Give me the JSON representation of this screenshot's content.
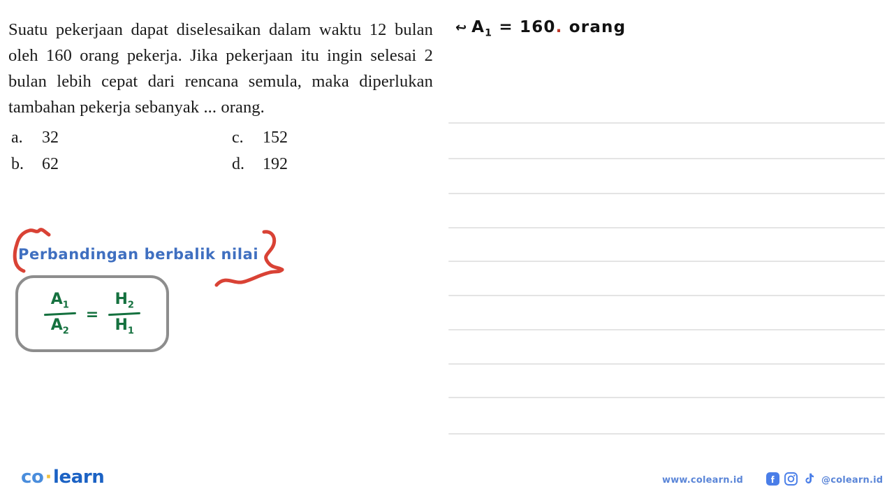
{
  "question": {
    "text": "Suatu pekerjaan dapat diselesaikan dalam waktu 12 bulan oleh 160 orang pekerja. Jika pekerjaan itu ingin selesai 2 bulan lebih cepat dari rencana semula, maka diperlukan tambahan pekerja sebanyak ... orang.",
    "options": [
      {
        "key": "a.",
        "value": "32"
      },
      {
        "key": "b.",
        "value": "62"
      },
      {
        "key": "c.",
        "value": "152"
      },
      {
        "key": "d.",
        "value": "192"
      }
    ]
  },
  "annotations": {
    "top_right": {
      "arrow": "↩",
      "label": "A",
      "sub": "1",
      "equals": "=",
      "value": "160",
      "dot": ".",
      "unit": "orang",
      "color": "#121212",
      "dot_color": "#c0392b"
    },
    "concept": {
      "label": "Perbandingan berbalik nilai",
      "color": "#3f6fc0",
      "bracket_color": "#d94235"
    },
    "formula": {
      "left_num": "A",
      "left_num_sub": "1",
      "left_den": "A",
      "left_den_sub": "2",
      "equals": "=",
      "right_num": "H",
      "right_num_sub": "2",
      "right_den": "H",
      "right_den_sub": "1",
      "color": "#15713f",
      "box_color": "#8d8d8d"
    }
  },
  "worksheet": {
    "line_color": "#e4e4e4",
    "line_positions": [
      175,
      226,
      276,
      325,
      373,
      422,
      471,
      520,
      568,
      620
    ]
  },
  "footer": {
    "logo": {
      "first": "co",
      "dot": "·",
      "second": "learn"
    },
    "url": "www.colearn.id",
    "handle": "@colearn.id",
    "social": [
      {
        "name": "facebook-icon"
      },
      {
        "name": "instagram-icon"
      },
      {
        "name": "tiktok-icon"
      }
    ],
    "accent_color": "#5b86d8"
  }
}
